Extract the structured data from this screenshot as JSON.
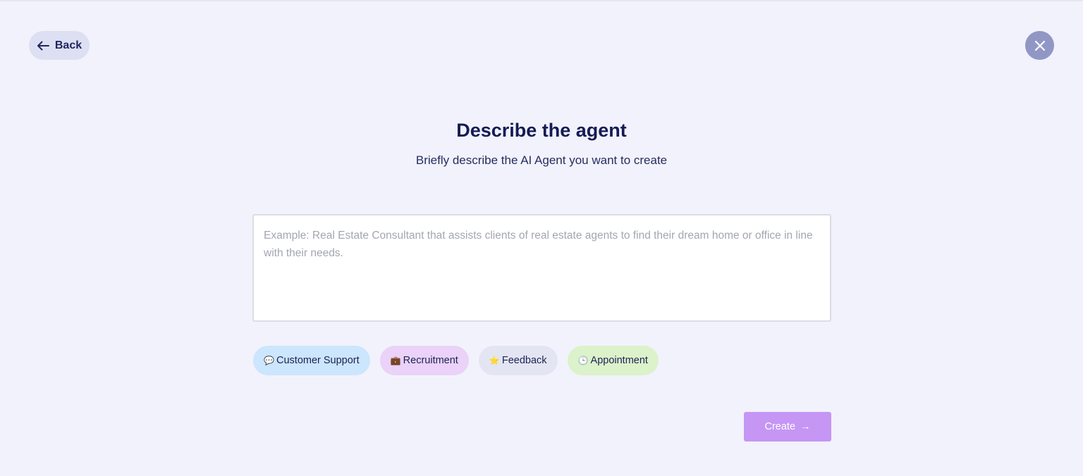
{
  "header": {
    "back_label": "Back",
    "close_icon": "close-icon",
    "back_icon": "arrow-left-icon"
  },
  "main": {
    "title": "Describe the agent",
    "subtitle": "Briefly describe the AI Agent you want to create",
    "description": {
      "value": "",
      "placeholder": "Example: Real Estate Consultant that assists clients of real estate agents to find their dream home or office in line with their needs."
    },
    "chips": [
      {
        "emoji": "💬",
        "icon": "speech-bubble-icon",
        "label": "Customer Support",
        "color": "#cbe6fd"
      },
      {
        "emoji": "💼",
        "icon": "briefcase-icon",
        "label": "Recruitment",
        "color": "#ead2f8"
      },
      {
        "emoji": "⭐",
        "icon": "star-icon",
        "label": "Feedback",
        "color": "#e4e5f2"
      },
      {
        "emoji": "🕒",
        "icon": "clock-icon",
        "label": "Appointment",
        "color": "#dcf2ca"
      }
    ],
    "create_label": "Create",
    "create_arrow": "→"
  },
  "colors": {
    "background": "#f2f2fc",
    "accent": "#c596f4",
    "text": "#141b55"
  }
}
